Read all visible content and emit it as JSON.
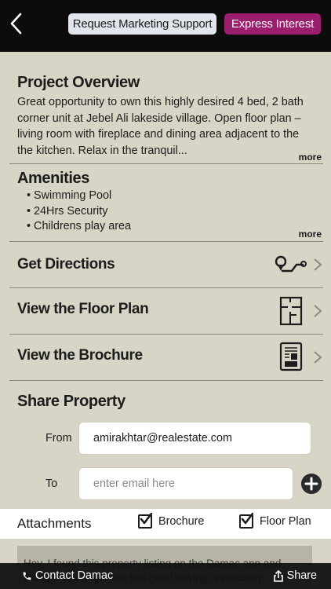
{
  "header": {
    "request_support_label": "Request Marketing Support",
    "express_interest_label": "Express Interest"
  },
  "overview": {
    "title": "Project Overview",
    "text": "Great opportunity to own this highly desired 4 bed, 2 bath corner unit at Jebel Ali lakeside village. Open floor plan – living room with fireplace and dining area adjacent to the the kitchen. Relax in the tranquil...",
    "more_label": "more"
  },
  "amenities": {
    "title": "Amenities",
    "items": [
      "Swimming Pool",
      "24Hrs Security",
      "Childrens play area"
    ],
    "more_label": "more"
  },
  "rows": {
    "directions": "Get Directions",
    "floor_plan": "View the Floor Plan",
    "brochure": "View the Brochure"
  },
  "share": {
    "title": "Share Property",
    "from_label": "From",
    "from_value": "amirakhtar@realestate.com",
    "to_label": "To",
    "to_placeholder": "enter email here"
  },
  "attachments": {
    "title": "Attachments",
    "brochure_label": "Brochure",
    "brochure_checked": true,
    "floor_plan_label": "Floor Plan",
    "floor_plan_checked": true
  },
  "message": {
    "text": "Hey, I found this property listing on the Damac app and thought you might like this great buying opportunity."
  },
  "footer": {
    "contact_label": "Contact Damac",
    "share_label": "Share"
  },
  "colors": {
    "background": "#d8d4c6",
    "topbar": "#0c0c0c",
    "accent": "#9b1d6d",
    "support_button": "#e1e6ec"
  }
}
